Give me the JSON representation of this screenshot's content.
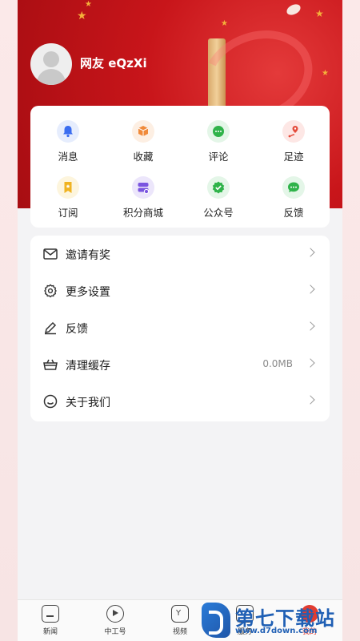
{
  "profile": {
    "username": "网友 eQzXi"
  },
  "quick_actions": [
    {
      "label": "消息",
      "icon": "bell-icon",
      "color": "#3a6df0",
      "bg": "#e6edfd"
    },
    {
      "label": "收藏",
      "icon": "box-icon",
      "color": "#f08a3a",
      "bg": "#fdefe3"
    },
    {
      "label": "评论",
      "icon": "chat-icon",
      "color": "#2fb34a",
      "bg": "#e4f6e8"
    },
    {
      "label": "足迹",
      "icon": "footprint-pin-icon",
      "color": "#e44c3c",
      "bg": "#fde7e5"
    },
    {
      "label": "订阅",
      "icon": "bookmark-icon",
      "color": "#f0b321",
      "bg": "#fdf5dd"
    },
    {
      "label": "积分商城",
      "icon": "points-store-icon",
      "color": "#7a55e0",
      "bg": "#ece6fb"
    },
    {
      "label": "公众号",
      "icon": "verified-badge-icon",
      "color": "#2fb34a",
      "bg": "#e4f6e8"
    },
    {
      "label": "反馈",
      "icon": "feedback-chat-icon",
      "color": "#2fb34a",
      "bg": "#e4f6e8"
    }
  ],
  "settings_list": [
    {
      "label": "邀请有奖",
      "icon": "mail-icon",
      "value": ""
    },
    {
      "label": "更多设置",
      "icon": "gear-icon",
      "value": ""
    },
    {
      "label": "反馈",
      "icon": "pencil-icon",
      "value": ""
    },
    {
      "label": "清理缓存",
      "icon": "basket-icon",
      "value": "0.0MB"
    },
    {
      "label": "关于我们",
      "icon": "smile-icon",
      "value": ""
    }
  ],
  "tabbar": [
    {
      "label": "新闻",
      "icon": "news-home-icon"
    },
    {
      "label": "中工号",
      "icon": "play-circle-icon"
    },
    {
      "label": "视频",
      "icon": "video-hexagon-icon"
    },
    {
      "label": "服务",
      "icon": "service-icon"
    },
    {
      "label": "我的",
      "icon": "profile-icon",
      "active": true
    }
  ],
  "watermark": {
    "title": "第七下载站",
    "url": "www.d7down.com"
  }
}
